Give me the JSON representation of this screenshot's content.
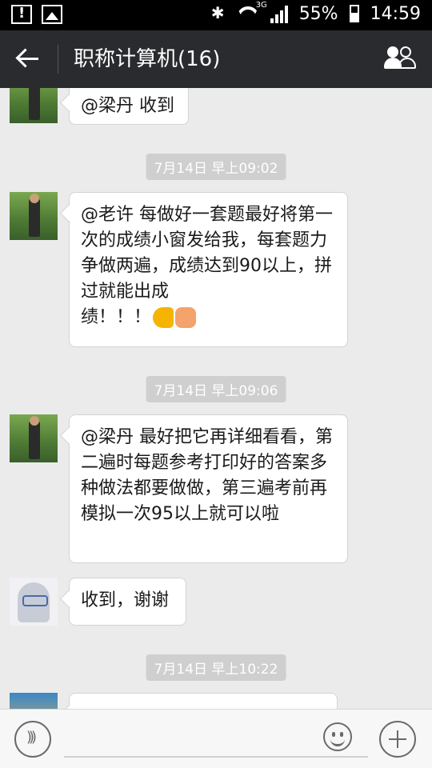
{
  "status_bar": {
    "network": "3G",
    "battery": "55%",
    "time": "14:59",
    "icons": [
      "warning-icon",
      "image-icon",
      "bluetooth-icon",
      "wifi-icon",
      "signal-icon",
      "battery-icon"
    ]
  },
  "header": {
    "title": "职称计算机(16)",
    "back_icon": "arrow-left-icon",
    "members_icon": "group-icon"
  },
  "messages": [
    {
      "type": "text",
      "avatar": "photo",
      "text": "@梁丹 收到"
    },
    {
      "type": "timestamp",
      "text": "7月14日 早上09:02"
    },
    {
      "type": "text",
      "avatar": "photo",
      "text": "@老许 每做好一套题最好将第一次的成绩小窗发给我，每套题力争做两遍，成绩达到90以上，拼过就能出成",
      "text2": "绩！！！",
      "emojis": [
        "flexed-biceps-emoji",
        "raised-fist-emoji"
      ]
    },
    {
      "type": "timestamp",
      "text": "7月14日 早上09:06"
    },
    {
      "type": "text",
      "avatar": "photo",
      "text": "@梁丹 最好把它再详细看看，第二遍时每题参考打印好的答案多种做法都要做做，第三遍考前再模拟一次95以上就可以啦"
    },
    {
      "type": "text",
      "avatar": "anime",
      "text": "收到，谢谢"
    },
    {
      "type": "timestamp",
      "text": "7月14日 早上10:22"
    },
    {
      "type": "text",
      "avatar": "blue",
      "text": ""
    }
  ],
  "input_bar": {
    "voice_icon": "voice-icon",
    "emoji_icon": "emoji-icon",
    "add_icon": "plus-icon",
    "placeholder": ""
  }
}
